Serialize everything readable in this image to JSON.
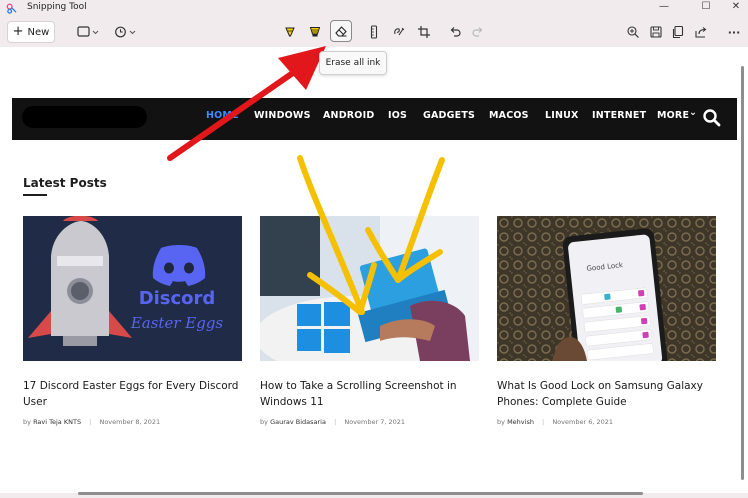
{
  "window": {
    "title": "Snipping Tool",
    "min_glyph": "—",
    "max_glyph": "☐",
    "close_glyph": "✕"
  },
  "toolbar": {
    "new_label": "New",
    "more_glyph": "···",
    "tooltip": "Erase all ink"
  },
  "site": {
    "nav": [
      "HOME",
      "WINDOWS",
      "ANDROID",
      "IOS",
      "GADGETS",
      "MACOS",
      "LINUX",
      "INTERNET",
      "MORE"
    ],
    "more_chevron": "⌄",
    "section_title": "Latest Posts",
    "posts": [
      {
        "title": "17 Discord Easter Eggs for Every Discord User",
        "author_prefix": "by",
        "author": "Ravi Teja KNTS",
        "date": "November 8, 2021",
        "image_text_1": "Discord",
        "image_text_2": "Easter Eggs"
      },
      {
        "title": "How to Take a Scrolling Screenshot in Windows 11",
        "author_prefix": "by",
        "author": "Gaurav Bidasaria",
        "date": "November 7, 2021"
      },
      {
        "title": "What Is Good Lock on Samsung Galaxy Phones: Complete Guide",
        "author_prefix": "by",
        "author": "Mehvish",
        "date": "November 6, 2021",
        "image_text_1": "Good Lock"
      }
    ]
  },
  "colors": {
    "accent_nav": "#3b8cff",
    "ink_yellow": "#f5c000",
    "arrow_red": "#e2171b",
    "discord_blue": "#5865f2"
  }
}
